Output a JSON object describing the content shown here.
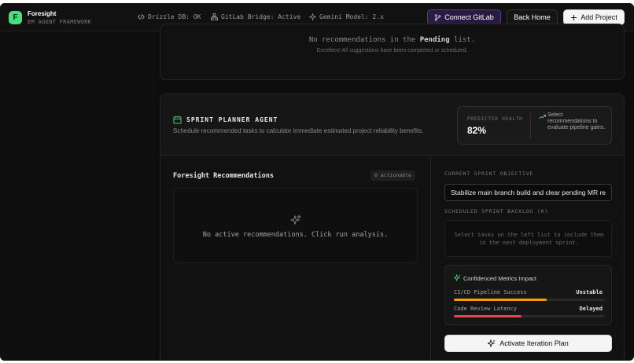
{
  "app": {
    "logo_letter": "F",
    "name": "Foresight",
    "subtitle": "EM AGENT FRAMEWORK"
  },
  "header": {
    "statuses": [
      {
        "icon": "code-icon",
        "label": "Drizzle DB: OK"
      },
      {
        "icon": "network-icon",
        "label": "GitLab Bridge: Active"
      },
      {
        "icon": "sparkle-icon",
        "label": "Gemini Model: 2.x"
      }
    ],
    "connect_gitlab": "Connect GitLab",
    "back_home": "Back Home",
    "add_project": "Add Project"
  },
  "pending": {
    "message_prefix": "No recommendations in the ",
    "message_bold": "Pending",
    "message_suffix": " list.",
    "sub": "Excellent! All suggestions have been completed or scheduled."
  },
  "sprint": {
    "title": "SPRINT PLANNER AGENT",
    "description": "Schedule recommended tasks to calculate immediate estimated project reliability benefits.",
    "health": {
      "label": "PREDICTED HEALTH",
      "value": "82%",
      "note": "Select recommendations to evaluate pipeline gains."
    },
    "recommendations": {
      "title": "Foresight Recommendations",
      "badge": "0 actionable",
      "empty": "No active recommendations. Click run analysis."
    },
    "objective": {
      "label": "CURRENT SPRINT OBJECTIVE",
      "value": "Stabilize main branch build and clear pending MR reviews"
    },
    "backlog": {
      "label": "SCHEDULED SPRINT BACKLOG (0)",
      "empty": "Select tasks on the left list to include them in the next deployment sprint."
    },
    "metrics": {
      "title": "Confidenced Metrics Impact",
      "items": [
        {
          "name": "CI/CD Pipeline Success",
          "status": "Unstable",
          "level": 0.62,
          "color": "#f59e0b"
        },
        {
          "name": "Code Review Latency",
          "status": "Delayed",
          "level": 0.45,
          "color": "#ef4444"
        }
      ]
    },
    "activate": "Activate Iteration Plan"
  },
  "colors": {
    "accent_green": "#4ade80",
    "gitlab_purple": "#5b3a8a",
    "warning": "#f59e0b",
    "danger": "#ef4444"
  }
}
